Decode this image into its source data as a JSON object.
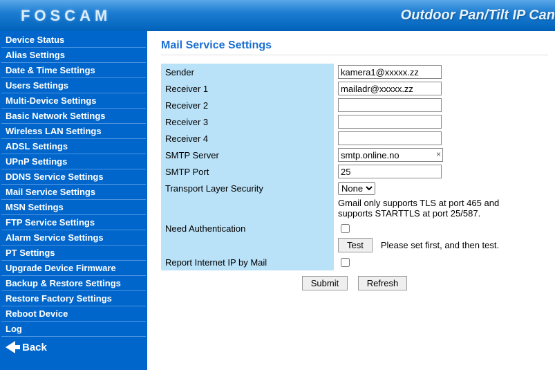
{
  "header": {
    "brand": "FOSCAM",
    "product": "Outdoor Pan/Tilt IP Can"
  },
  "sidebar": {
    "items": [
      "Device Status",
      "Alias Settings",
      "Date & Time Settings",
      "Users Settings",
      "Multi-Device Settings",
      "Basic Network Settings",
      "Wireless LAN Settings",
      "ADSL Settings",
      "UPnP Settings",
      "DDNS Service Settings",
      "Mail Service Settings",
      "MSN Settings",
      "FTP Service Settings",
      "Alarm Service Settings",
      "PT Settings",
      "Upgrade Device Firmware",
      "Backup & Restore Settings",
      "Restore Factory Settings",
      "Reboot Device",
      "Log"
    ],
    "back": "Back"
  },
  "page": {
    "title": "Mail Service Settings",
    "labels": {
      "sender": "Sender",
      "receiver1": "Receiver 1",
      "receiver2": "Receiver 2",
      "receiver3": "Receiver 3",
      "receiver4": "Receiver 4",
      "smtp_server": "SMTP Server",
      "smtp_port": "SMTP Port",
      "tls": "Transport Layer Security",
      "tls_note": "Gmail only supports TLS at port 465 and supports STARTTLS at port 25/587.",
      "need_auth": "Need Authentication",
      "test_note": "Please set first, and then test.",
      "report_ip": "Report Internet IP by Mail"
    },
    "values": {
      "sender": "kamera1@xxxxx.zz",
      "receiver1": "mailadr@xxxxx.zz",
      "receiver2": "",
      "receiver3": "",
      "receiver4": "",
      "smtp_server": "smtp.online.no",
      "smtp_port": "25",
      "tls": "None"
    },
    "buttons": {
      "test": "Test",
      "submit": "Submit",
      "refresh": "Refresh"
    }
  }
}
